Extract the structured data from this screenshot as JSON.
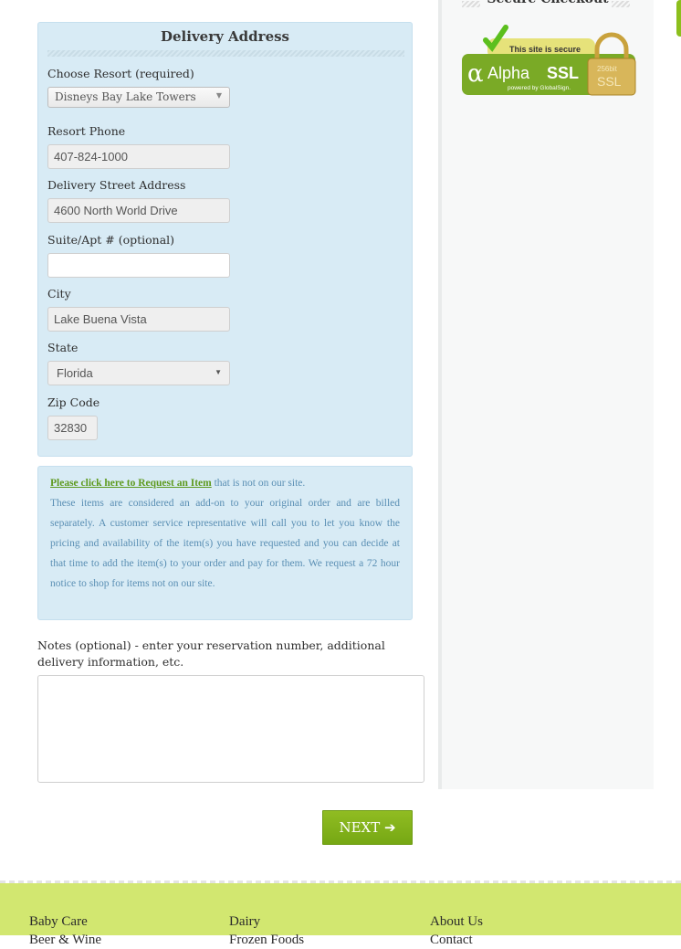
{
  "delivery": {
    "title": "Delivery Address",
    "resort": {
      "label": "Choose Resort (required)",
      "value": "Disneys Bay Lake Towers"
    },
    "phone": {
      "label": "Resort Phone",
      "value": "407-824-1000"
    },
    "street": {
      "label": "Delivery Street Address",
      "value": "4600 North World Drive"
    },
    "suite": {
      "label": "Suite/Apt # (optional)",
      "value": ""
    },
    "city": {
      "label": "City",
      "value": "Lake Buena Vista"
    },
    "state": {
      "label": "State",
      "value": "Florida"
    },
    "zip": {
      "label": "Zip Code",
      "value": "32830"
    }
  },
  "request_info": {
    "link": "Please click here to Request an Item",
    "link_suffix": " that is not on our site.",
    "body": "These items are considered an add-on to your original order and are billed separately. A customer service representative will call you to let you know the pricing and availability of the item(s) you have requested and you can decide at that time to add the item(s) to your order and pay for them. We request a 72 hour notice to shop for items not on our site."
  },
  "notes": {
    "label": "Notes (optional) - enter your reservation number, additional delivery information, etc.",
    "value": ""
  },
  "next_button": {
    "label": "NEXT",
    "icon": "arrow-right-icon"
  },
  "sidebar": {
    "title": "Secure Checkout",
    "badge": {
      "top": "This site is secure",
      "brand_alpha": "α",
      "brand_light": "Alpha",
      "brand_bold": "SSL",
      "sub": "powered by GlobalSign.",
      "lock_top": "256bit",
      "lock_bottom": "SSL"
    }
  },
  "footer": {
    "columns": [
      [
        "Baby Care",
        "Beer & Wine"
      ],
      [
        "Dairy",
        "Frozen Foods"
      ],
      [
        "About Us",
        "Contact"
      ]
    ]
  },
  "colors": {
    "panel_bg": "#d8ebf5",
    "accent_green": "#80b11a",
    "footer_bg": "#d2e770",
    "info_text": "#5a8fb4"
  }
}
